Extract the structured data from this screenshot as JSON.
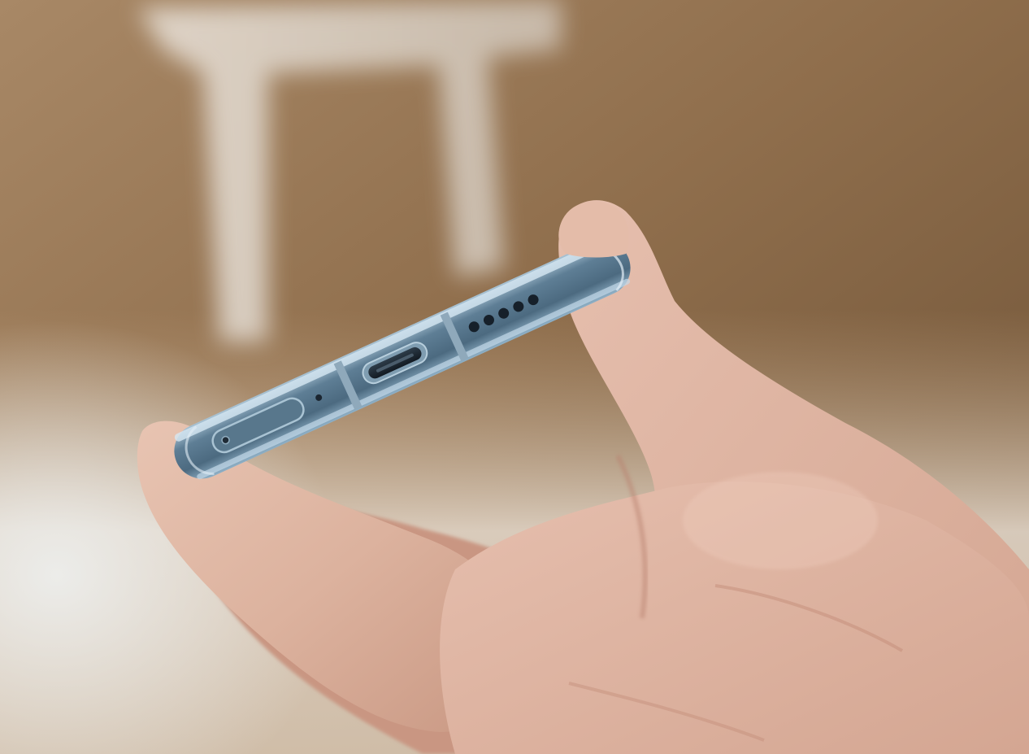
{
  "scene": {
    "subject": "smartphone-bottom-edge",
    "colors": {
      "background_warm": "#9c7b57",
      "background_dark": "#6e5236",
      "floor_light": "#e6dcd0",
      "chair_white": "#f1ece6",
      "skin_base": "#e0b9a7",
      "skin_shadow": "#b88470",
      "phone_frame": "#6f8da3",
      "phone_edge_highlight": "#cfe2ef",
      "phone_port_dark": "#1b2530"
    },
    "details": {
      "speaker_holes": 5,
      "usb_port": "usb-c-port",
      "sim_tray": "sim-tray",
      "microphone_hole": "microphone-hole"
    }
  }
}
